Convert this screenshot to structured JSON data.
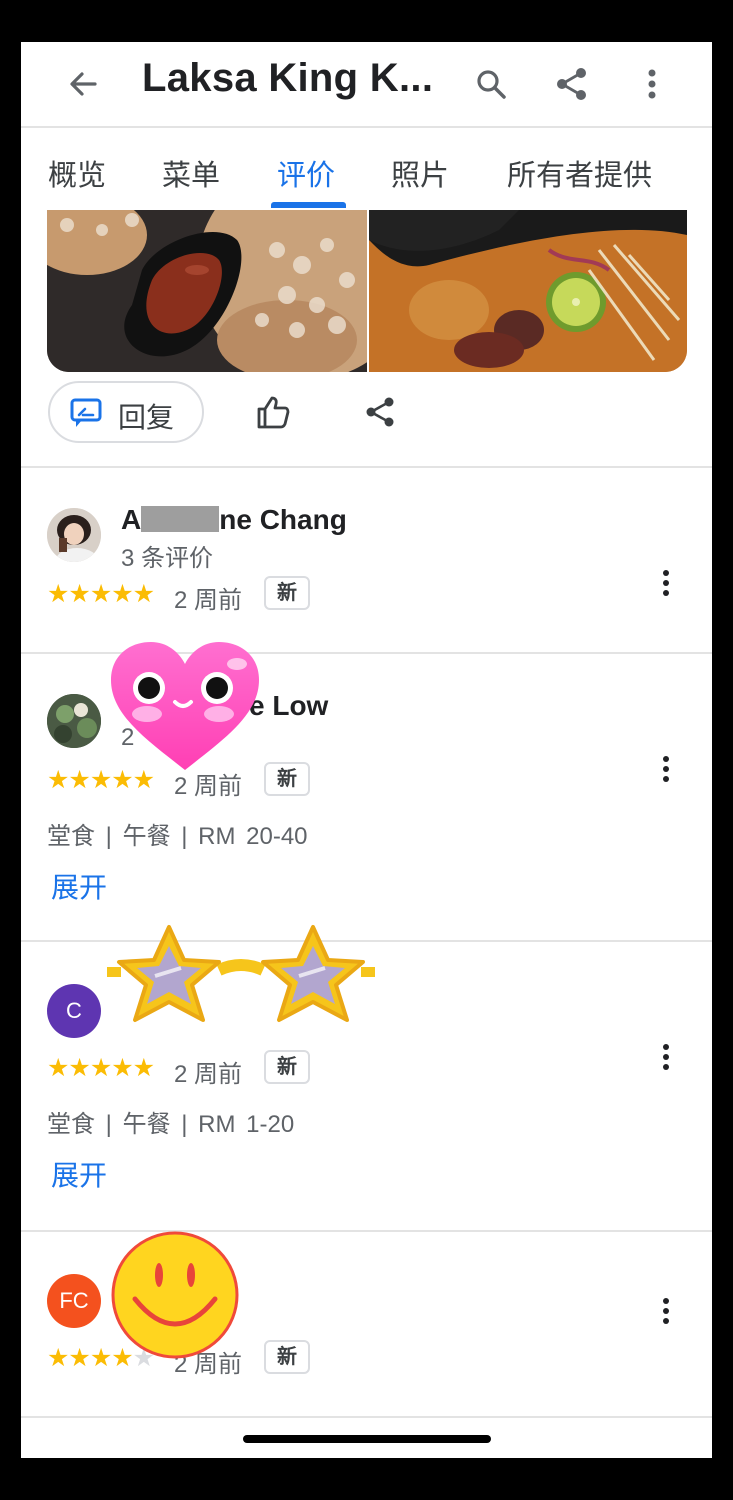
{
  "header": {
    "title": "Laksa King K...",
    "icons": [
      "back-arrow-icon",
      "search-icon",
      "share-icon",
      "more-vert-icon"
    ]
  },
  "tabs": [
    {
      "label": "概览",
      "active": false
    },
    {
      "label": "菜单",
      "active": false
    },
    {
      "label": "评价",
      "active": true
    },
    {
      "label": "照片",
      "active": false
    },
    {
      "label": "所有者提供",
      "active": false
    }
  ],
  "actions": {
    "reply_label": "回复",
    "icons": [
      "reply-icon",
      "thumbs-up-icon",
      "share-icon"
    ]
  },
  "reviews": [
    {
      "name_prefix": "A",
      "name_suffix": "ne Chang",
      "subtitle": "3 条评价",
      "rating": 5,
      "time_ago": "2 周前",
      "badge": "新"
    },
    {
      "name_suffix": "e Low",
      "subtitle": "2",
      "rating": 5,
      "time_ago": "2 周前",
      "badge": "新",
      "meta": "堂食 | 午餐 | RM 20-40",
      "expand_label": "展开"
    },
    {
      "avatar_letter": "C",
      "avatar_color": "#5e35b1",
      "rating": 5,
      "time_ago": "2 周前",
      "badge": "新",
      "meta": "堂食 | 午餐 | RM 1-20",
      "expand_label": "展开"
    },
    {
      "avatar_letter": "FC",
      "avatar_color": "#f4511e",
      "rating": 4,
      "time_ago": "2 周前",
      "badge": "新"
    }
  ],
  "stickers": [
    "heart-face-sticker",
    "star-sunglasses-sticker",
    "smiley-face-sticker"
  ],
  "colors": {
    "accent": "#1a73e8",
    "star": "#fbbc04"
  }
}
